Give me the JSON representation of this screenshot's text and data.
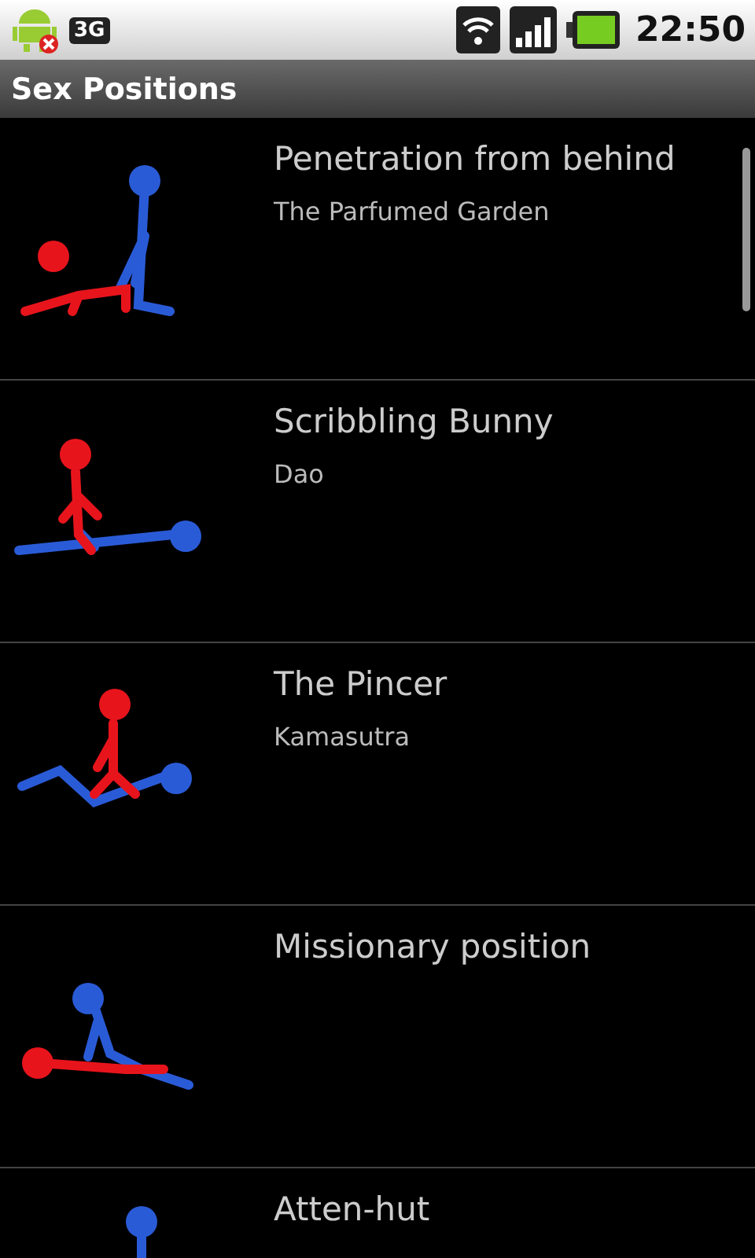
{
  "status_bar": {
    "network": "3G",
    "time": "22:50"
  },
  "title": "Sex Positions",
  "items": [
    {
      "title": "Penetration from behind",
      "subtitle": "The Parfumed Garden"
    },
    {
      "title": "Scribbling Bunny",
      "subtitle": "Dao"
    },
    {
      "title": "The Pincer",
      "subtitle": "Kamasutra"
    },
    {
      "title": "Missionary position"
    },
    {
      "title": "Atten-hut"
    }
  ]
}
